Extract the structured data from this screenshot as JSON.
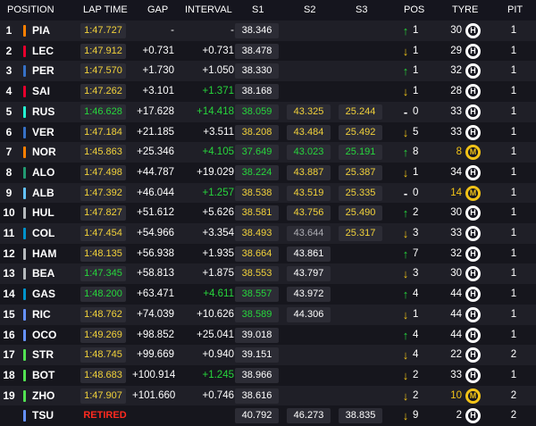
{
  "headers": {
    "position": "POSITION",
    "lap_time": "LAP TIME",
    "gap": "GAP",
    "interval": "INTERVAL",
    "s1": "S1",
    "s2": "S2",
    "s3": "S3",
    "pos": "POS",
    "tyre": "TYRE",
    "pit": "PIT"
  },
  "colors": {
    "background": "#15151e",
    "row_alt": "#1f1f27",
    "purple_green": "#27d63c",
    "yellow": "#f2d23a",
    "retired_red": "#ff2a1f"
  },
  "rows": [
    {
      "pos": "1",
      "team_color": "#ff8000",
      "driver": "PIA",
      "lap": "1:47.727",
      "lap_class": "",
      "gap": "-",
      "interval": "-",
      "int_class": "",
      "s1": "38.346",
      "s1c": "",
      "s2": "",
      "s2c": "",
      "s3": "",
      "s3c": "",
      "arrow": "↑",
      "arrow_class": "up",
      "pchg": "1",
      "tyre_laps": "30",
      "tl_class": "",
      "tyre": "H",
      "pit": "1"
    },
    {
      "pos": "2",
      "team_color": "#e8002d",
      "driver": "LEC",
      "lap": "1:47.912",
      "lap_class": "",
      "gap": "+0.731",
      "interval": "+0.731",
      "int_class": "",
      "s1": "38.478",
      "s1c": "",
      "s2": "",
      "s2c": "",
      "s3": "",
      "s3c": "",
      "arrow": "↓",
      "arrow_class": "down",
      "pchg": "1",
      "tyre_laps": "29",
      "tl_class": "",
      "tyre": "H",
      "pit": "1"
    },
    {
      "pos": "3",
      "team_color": "#3671c6",
      "driver": "PER",
      "lap": "1:47.570",
      "lap_class": "",
      "gap": "+1.730",
      "interval": "+1.050",
      "int_class": "",
      "s1": "38.330",
      "s1c": "",
      "s2": "",
      "s2c": "",
      "s3": "",
      "s3c": "",
      "arrow": "↑",
      "arrow_class": "up",
      "pchg": "1",
      "tyre_laps": "32",
      "tl_class": "",
      "tyre": "H",
      "pit": "1"
    },
    {
      "pos": "4",
      "team_color": "#e8002d",
      "driver": "SAI",
      "lap": "1:47.262",
      "lap_class": "",
      "gap": "+3.101",
      "interval": "+1.371",
      "int_class": "g",
      "s1": "38.168",
      "s1c": "",
      "s2": "",
      "s2c": "",
      "s3": "",
      "s3c": "",
      "arrow": "↓",
      "arrow_class": "down",
      "pchg": "1",
      "tyre_laps": "28",
      "tl_class": "",
      "tyre": "H",
      "pit": "1"
    },
    {
      "pos": "5",
      "team_color": "#27f4d2",
      "driver": "RUS",
      "lap": "1:46.628",
      "lap_class": "best",
      "gap": "+17.628",
      "interval": "+14.418",
      "int_class": "g",
      "s1": "38.059",
      "s1c": "g",
      "s2": "43.325",
      "s2c": "y",
      "s3": "25.244",
      "s3c": "y",
      "arrow": "-",
      "arrow_class": "same",
      "pchg": "0",
      "tyre_laps": "33",
      "tl_class": "",
      "tyre": "H",
      "pit": "1"
    },
    {
      "pos": "6",
      "team_color": "#3671c6",
      "driver": "VER",
      "lap": "1:47.184",
      "lap_class": "",
      "gap": "+21.185",
      "interval": "+3.511",
      "int_class": "",
      "s1": "38.208",
      "s1c": "y",
      "s2": "43.484",
      "s2c": "y",
      "s3": "25.492",
      "s3c": "y",
      "arrow": "↓",
      "arrow_class": "down",
      "pchg": "5",
      "tyre_laps": "33",
      "tl_class": "",
      "tyre": "H",
      "pit": "1"
    },
    {
      "pos": "7",
      "team_color": "#ff8000",
      "driver": "NOR",
      "lap": "1:45.863",
      "lap_class": "",
      "gap": "+25.346",
      "interval": "+4.105",
      "int_class": "g",
      "s1": "37.649",
      "s1c": "g",
      "s2": "43.023",
      "s2c": "g",
      "s3": "25.191",
      "s3c": "g",
      "arrow": "↑",
      "arrow_class": "up",
      "pchg": "8",
      "tyre_laps": "8",
      "tl_class": "y",
      "tyre": "M",
      "pit": "1"
    },
    {
      "pos": "8",
      "team_color": "#229971",
      "driver": "ALO",
      "lap": "1:47.498",
      "lap_class": "",
      "gap": "+44.787",
      "interval": "+19.029",
      "int_class": "",
      "s1": "38.224",
      "s1c": "g",
      "s2": "43.887",
      "s2c": "y",
      "s3": "25.387",
      "s3c": "y",
      "arrow": "↓",
      "arrow_class": "down",
      "pchg": "1",
      "tyre_laps": "34",
      "tl_class": "",
      "tyre": "H",
      "pit": "1"
    },
    {
      "pos": "9",
      "team_color": "#64c4ff",
      "driver": "ALB",
      "lap": "1:47.392",
      "lap_class": "",
      "gap": "+46.044",
      "interval": "+1.257",
      "int_class": "g",
      "s1": "38.538",
      "s1c": "y",
      "s2": "43.519",
      "s2c": "y",
      "s3": "25.335",
      "s3c": "y",
      "arrow": "-",
      "arrow_class": "same",
      "pchg": "0",
      "tyre_laps": "14",
      "tl_class": "y",
      "tyre": "M",
      "pit": "1"
    },
    {
      "pos": "10",
      "team_color": "#b6babd",
      "driver": "HUL",
      "lap": "1:47.827",
      "lap_class": "",
      "gap": "+51.612",
      "interval": "+5.626",
      "int_class": "",
      "s1": "38.581",
      "s1c": "y",
      "s2": "43.756",
      "s2c": "y",
      "s3": "25.490",
      "s3c": "y",
      "arrow": "↑",
      "arrow_class": "up",
      "pchg": "2",
      "tyre_laps": "30",
      "tl_class": "",
      "tyre": "H",
      "pit": "1"
    },
    {
      "pos": "11",
      "team_color": "#0093cc",
      "driver": "COL",
      "lap": "1:47.454",
      "lap_class": "",
      "gap": "+54.966",
      "interval": "+3.354",
      "int_class": "",
      "s1": "38.493",
      "s1c": "y",
      "s2": "43.644",
      "s2c": "gr",
      "s3": "25.317",
      "s3c": "y",
      "arrow": "↓",
      "arrow_class": "down",
      "pchg": "3",
      "tyre_laps": "33",
      "tl_class": "",
      "tyre": "H",
      "pit": "1"
    },
    {
      "pos": "12",
      "team_color": "#b6babd",
      "driver": "HAM",
      "lap": "1:48.135",
      "lap_class": "",
      "gap": "+56.938",
      "interval": "+1.935",
      "int_class": "",
      "s1": "38.664",
      "s1c": "y",
      "s2": "43.861",
      "s2c": "",
      "s3": "",
      "s3c": "",
      "arrow": "↑",
      "arrow_class": "up",
      "pchg": "7",
      "tyre_laps": "32",
      "tl_class": "",
      "tyre": "H",
      "pit": "1"
    },
    {
      "pos": "13",
      "team_color": "#b6babd",
      "driver": "BEA",
      "lap": "1:47.345",
      "lap_class": "best",
      "gap": "+58.813",
      "interval": "+1.875",
      "int_class": "",
      "s1": "38.553",
      "s1c": "y",
      "s2": "43.797",
      "s2c": "",
      "s3": "",
      "s3c": "",
      "arrow": "↓",
      "arrow_class": "down",
      "pchg": "3",
      "tyre_laps": "30",
      "tl_class": "",
      "tyre": "H",
      "pit": "1"
    },
    {
      "pos": "14",
      "team_color": "#0093cc",
      "driver": "GAS",
      "lap": "1:48.200",
      "lap_class": "best",
      "gap": "+63.471",
      "interval": "+4.611",
      "int_class": "g",
      "s1": "38.557",
      "s1c": "g",
      "s2": "43.972",
      "s2c": "",
      "s3": "",
      "s3c": "",
      "arrow": "↑",
      "arrow_class": "up",
      "pchg": "4",
      "tyre_laps": "44",
      "tl_class": "",
      "tyre": "H",
      "pit": "1"
    },
    {
      "pos": "15",
      "team_color": "#6692ff",
      "driver": "RIC",
      "lap": "1:48.762",
      "lap_class": "",
      "gap": "+74.039",
      "interval": "+10.626",
      "int_class": "",
      "s1": "38.589",
      "s1c": "g",
      "s2": "44.306",
      "s2c": "",
      "s3": "",
      "s3c": "",
      "arrow": "↓",
      "arrow_class": "down",
      "pchg": "1",
      "tyre_laps": "44",
      "tl_class": "",
      "tyre": "H",
      "pit": "1"
    },
    {
      "pos": "16",
      "team_color": "#6692ff",
      "driver": "OCO",
      "lap": "1:49.269",
      "lap_class": "",
      "gap": "+98.852",
      "interval": "+25.041",
      "int_class": "",
      "s1": "39.018",
      "s1c": "",
      "s2": "",
      "s2c": "",
      "s3": "",
      "s3c": "",
      "arrow": "↑",
      "arrow_class": "up",
      "pchg": "4",
      "tyre_laps": "44",
      "tl_class": "",
      "tyre": "H",
      "pit": "1"
    },
    {
      "pos": "17",
      "team_color": "#52e252",
      "driver": "STR",
      "lap": "1:48.745",
      "lap_class": "",
      "gap": "+99.669",
      "interval": "+0.940",
      "int_class": "",
      "s1": "39.151",
      "s1c": "",
      "s2": "",
      "s2c": "",
      "s3": "",
      "s3c": "",
      "arrow": "↓",
      "arrow_class": "down",
      "pchg": "4",
      "tyre_laps": "22",
      "tl_class": "",
      "tyre": "H",
      "pit": "2"
    },
    {
      "pos": "18",
      "team_color": "#52e252",
      "driver": "BOT",
      "lap": "1:48.683",
      "lap_class": "",
      "gap": "+100.914",
      "interval": "+1.245",
      "int_class": "g",
      "s1": "38.966",
      "s1c": "",
      "s2": "",
      "s2c": "",
      "s3": "",
      "s3c": "",
      "arrow": "↓",
      "arrow_class": "down",
      "pchg": "2",
      "tyre_laps": "33",
      "tl_class": "",
      "tyre": "H",
      "pit": "1"
    },
    {
      "pos": "19",
      "team_color": "#52e252",
      "driver": "ZHO",
      "lap": "1:47.907",
      "lap_class": "",
      "gap": "+101.660",
      "interval": "+0.746",
      "int_class": "",
      "s1": "38.616",
      "s1c": "",
      "s2": "",
      "s2c": "",
      "s3": "",
      "s3c": "",
      "arrow": "↓",
      "arrow_class": "down",
      "pchg": "2",
      "tyre_laps": "10",
      "tl_class": "y",
      "tyre": "M",
      "pit": "2"
    },
    {
      "pos": "",
      "team_color": "#6692ff",
      "driver": "TSU",
      "lap": "RETIRED",
      "lap_class": "ret",
      "gap": "",
      "interval": "",
      "int_class": "",
      "s1": "40.792",
      "s1c": "",
      "s2": "46.273",
      "s2c": "",
      "s3": "38.835",
      "s3c": "",
      "arrow": "↓",
      "arrow_class": "down",
      "pchg": "9",
      "tyre_laps": "2",
      "tl_class": "",
      "tyre": "H",
      "pit": "2"
    }
  ]
}
